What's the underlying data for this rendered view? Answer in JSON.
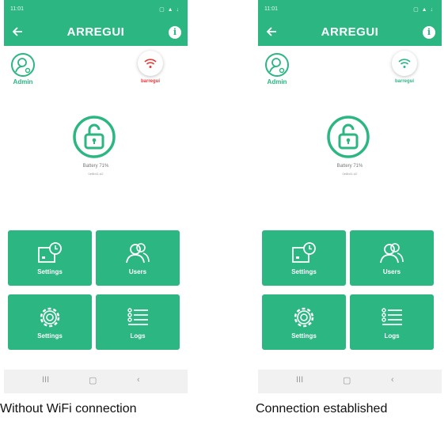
{
  "screens": [
    {
      "statusbar": {
        "time": "11:01",
        "system": "▢ ▲ ↓"
      },
      "app_title": "ARREGUI",
      "user_label": "Admin",
      "wifi": {
        "label": "barregui",
        "status": "disconnected",
        "color": "#e53935"
      },
      "battery_text": "Battery 71%",
      "device_text": "0e8b41:d2",
      "tiles": [
        {
          "label": "Settings",
          "icon": "clock-screen-icon"
        },
        {
          "label": "Users",
          "icon": "users-icon"
        },
        {
          "label": "Settings",
          "icon": "gear-icon"
        },
        {
          "label": "Logs",
          "icon": "list-icon"
        }
      ],
      "caption": "Without WiFi connection"
    },
    {
      "statusbar": {
        "time": "11:01",
        "system": "▢ ▲ ↓"
      },
      "app_title": "ARREGUI",
      "user_label": "Admin",
      "wifi": {
        "label": "barregui",
        "status": "connected",
        "color": "#2bb682"
      },
      "battery_text": "Battery 71%",
      "device_text": "0e8b41:d2",
      "tiles": [
        {
          "label": "Settings",
          "icon": "clock-screen-icon"
        },
        {
          "label": "Users",
          "icon": "users-icon"
        },
        {
          "label": "Settings",
          "icon": "gear-icon"
        },
        {
          "label": "Logs",
          "icon": "list-icon"
        }
      ],
      "caption": "Connection established"
    }
  ],
  "navbar": {
    "recent": "III",
    "home": "▢",
    "back": "‹"
  },
  "colors": {
    "accent": "#2bb682",
    "wifi_off": "#e53935"
  }
}
